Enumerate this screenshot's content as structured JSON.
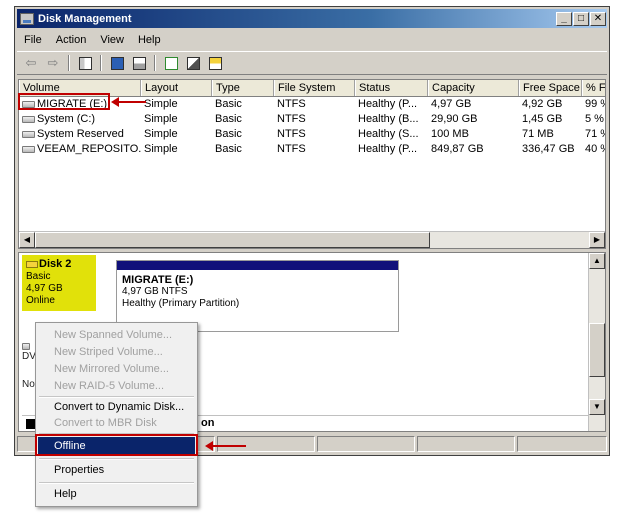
{
  "window": {
    "title": "Disk Management"
  },
  "menubar": [
    "File",
    "Action",
    "View",
    "Help"
  ],
  "toolbar": [
    {
      "icon": "back-arrow-icon",
      "glyph": "⇦"
    },
    {
      "icon": "forward-arrow-icon",
      "glyph": "⇨"
    },
    {
      "icon": "console-tree-icon"
    },
    {
      "icon": "help-icon"
    },
    {
      "icon": "view-icon"
    },
    {
      "icon": "refresh-icon"
    },
    {
      "icon": "properties-icon"
    },
    {
      "icon": "rescan-disks-icon"
    }
  ],
  "volumes": {
    "columns": [
      "Volume",
      "Layout",
      "Type",
      "File System",
      "Status",
      "Capacity",
      "Free Space",
      "% Fr"
    ],
    "rows": [
      [
        "MIGRATE (E:)",
        "Simple",
        "Basic",
        "NTFS",
        "Healthy (P...",
        "4,97 GB",
        "4,92 GB",
        "99 %"
      ],
      [
        "System (C:)",
        "Simple",
        "Basic",
        "NTFS",
        "Healthy (B...",
        "29,90 GB",
        "1,45 GB",
        "5 %"
      ],
      [
        "System Reserved",
        "Simple",
        "Basic",
        "NTFS",
        "Healthy (S...",
        "100 MB",
        "71 MB",
        "71 %"
      ],
      [
        "VEEAM_REPOSITO...",
        "Simple",
        "Basic",
        "NTFS",
        "Healthy (P...",
        "849,87 GB",
        "336,47 GB",
        "40 %"
      ]
    ]
  },
  "disk": {
    "name": "Disk 2",
    "type": "Basic",
    "size": "4,97 GB",
    "state": "Online",
    "partition": {
      "name": "MIGRATE  (E:)",
      "size_fs": "4,97 GB NTFS",
      "status": "Healthy (Primary Partition)"
    },
    "partial_labels": [
      "DV",
      "No"
    ],
    "legend_partial": "on"
  },
  "context_menu": {
    "items": [
      {
        "label": "New Spanned Volume...",
        "enabled": false
      },
      {
        "label": "New Striped Volume...",
        "enabled": false
      },
      {
        "label": "New Mirrored Volume...",
        "enabled": false
      },
      {
        "label": "New RAID-5 Volume...",
        "enabled": false
      },
      {
        "label": "Convert to Dynamic Disk...",
        "enabled": true
      },
      {
        "label": "Convert to MBR Disk",
        "enabled": false
      },
      {
        "label": "Offline",
        "enabled": true,
        "selected": true
      },
      {
        "label": "Properties",
        "enabled": true
      },
      {
        "label": "Help",
        "enabled": true
      }
    ]
  },
  "colors": {
    "titlebar": "#0a246a",
    "disk_highlight": "#e1e10a",
    "partition_bar": "#11117a",
    "annotation": "#c00000"
  }
}
